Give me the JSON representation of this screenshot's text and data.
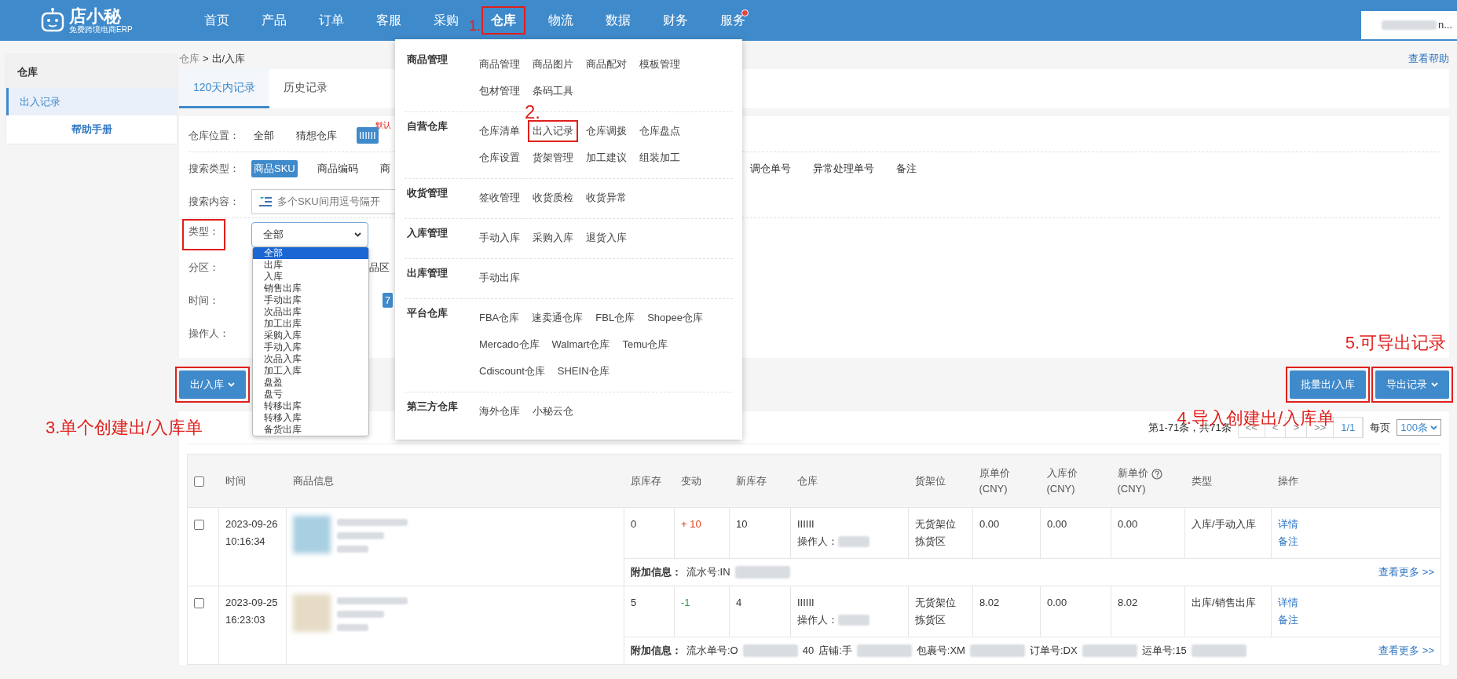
{
  "nav": {
    "logo": "店小秘",
    "tagline": "免费跨境电商ERP",
    "user": "n...",
    "items": [
      {
        "label": "首页",
        "selected": false,
        "outlined": false,
        "dot": false
      },
      {
        "label": "产品",
        "selected": false,
        "outlined": false,
        "dot": false
      },
      {
        "label": "订单",
        "selected": false,
        "outlined": false,
        "dot": false
      },
      {
        "label": "客服",
        "selected": false,
        "outlined": false,
        "dot": false
      },
      {
        "label": "采购",
        "selected": false,
        "outlined": false,
        "dot": false
      },
      {
        "label": "仓库",
        "selected": true,
        "outlined": true,
        "dot": false,
        "step": "1."
      },
      {
        "label": "物流",
        "selected": false,
        "outlined": false,
        "dot": false
      },
      {
        "label": "数据",
        "selected": false,
        "outlined": false,
        "dot": false
      },
      {
        "label": "财务",
        "selected": false,
        "outlined": false,
        "dot": false
      },
      {
        "label": "服务",
        "selected": false,
        "outlined": false,
        "dot": true
      }
    ]
  },
  "mega_menu": [
    {
      "title": "商品管理",
      "lines": [
        [
          {
            "label": "商品管理",
            "outlined": false
          },
          {
            "label": "商品图片",
            "outlined": false
          },
          {
            "label": "商品配对",
            "outlined": false
          },
          {
            "label": "模板管理",
            "outlined": false
          }
        ],
        [
          {
            "label": "包材管理",
            "outlined": false
          },
          {
            "label": "条码工具",
            "outlined": false
          }
        ]
      ]
    },
    {
      "title": "自营仓库",
      "lines": [
        [
          {
            "label": "仓库清单",
            "outlined": false
          },
          {
            "label": "出入记录",
            "outlined": true,
            "step": "2."
          },
          {
            "label": "仓库调拨",
            "outlined": false
          },
          {
            "label": "仓库盘点",
            "outlined": false
          }
        ],
        [
          {
            "label": "仓库设置",
            "outlined": false
          },
          {
            "label": "货架管理",
            "outlined": false
          },
          {
            "label": "加工建议",
            "outlined": false
          },
          {
            "label": "组装加工",
            "outlined": false
          }
        ]
      ]
    },
    {
      "title": "收货管理",
      "lines": [
        [
          {
            "label": "签收管理",
            "outlined": false
          },
          {
            "label": "收货质检",
            "outlined": false
          },
          {
            "label": "收货异常",
            "outlined": false
          }
        ]
      ]
    },
    {
      "title": "入库管理",
      "lines": [
        [
          {
            "label": "手动入库",
            "outlined": false
          },
          {
            "label": "采购入库",
            "outlined": false
          },
          {
            "label": "退货入库",
            "outlined": false
          }
        ]
      ]
    },
    {
      "title": "出库管理",
      "lines": [
        [
          {
            "label": "手动出库",
            "outlined": false
          }
        ]
      ]
    },
    {
      "title": "平台仓库",
      "lines": [
        [
          {
            "label": "FBA仓库",
            "outlined": false
          },
          {
            "label": "速卖通仓库",
            "outlined": false
          },
          {
            "label": "FBL仓库",
            "outlined": false
          },
          {
            "label": "Shopee仓库",
            "outlined": false
          }
        ],
        [
          {
            "label": "Mercado仓库",
            "outlined": false
          },
          {
            "label": "Walmart仓库",
            "outlined": false
          },
          {
            "label": "Temu仓库",
            "outlined": false
          }
        ],
        [
          {
            "label": "Cdiscount仓库",
            "outlined": false
          },
          {
            "label": "SHEIN仓库",
            "outlined": false
          }
        ]
      ]
    },
    {
      "title": "第三方仓库",
      "lines": [
        [
          {
            "label": "海外仓库",
            "outlined": false
          },
          {
            "label": "小秘云仓",
            "outlined": false
          }
        ]
      ]
    }
  ],
  "sidebar": {
    "title": "仓库",
    "items": [
      {
        "label": "出入记录",
        "selected": true
      }
    ],
    "help": "帮助手册"
  },
  "breadcrumb": [
    "仓库",
    "出/入库"
  ],
  "breadcrumb_separator": ">",
  "help_link": "查看帮助",
  "tabs": [
    {
      "label": "120天内记录",
      "selected": true
    },
    {
      "label": "历史记录",
      "selected": false
    }
  ],
  "filters": [
    {
      "label": "仓库位置：",
      "outlined": false,
      "kind": "options",
      "options": [
        {
          "label": "全部",
          "selected": false
        },
        {
          "label": "猜想仓库",
          "selected": false
        },
        {
          "label": "IIIIII",
          "selected": true,
          "tag": "默认"
        }
      ]
    },
    {
      "label": "搜索类型：",
      "outlined": false,
      "kind": "options",
      "options": [
        {
          "label": "商品SKU",
          "selected": true
        },
        {
          "label": "商品编码",
          "selected": false
        },
        {
          "label": "商",
          "selected": false
        }
      ],
      "options_right": [
        {
          "label": "调仓单号",
          "selected": false
        },
        {
          "label": "异常处理单号",
          "selected": false
        },
        {
          "label": "备注",
          "selected": false
        }
      ]
    },
    {
      "label": "搜索内容：",
      "outlined": false,
      "kind": "search",
      "placeholder": "多个SKU间用逗号隔开"
    },
    {
      "label": "类型：",
      "outlined": true,
      "kind": "select",
      "value": "全部",
      "choices": [
        {
          "label": "全部",
          "selected": true
        },
        {
          "label": "出库",
          "selected": false
        },
        {
          "label": "入库",
          "selected": false
        },
        {
          "label": "销售出库",
          "selected": false
        },
        {
          "label": "手动出库",
          "selected": false
        },
        {
          "label": "次品出库",
          "selected": false
        },
        {
          "label": "加工出库",
          "selected": false
        },
        {
          "label": "采购入库",
          "selected": false
        },
        {
          "label": "手动入库",
          "selected": false
        },
        {
          "label": "次品入库",
          "selected": false
        },
        {
          "label": "加工入库",
          "selected": false
        },
        {
          "label": "盘盈",
          "selected": false
        },
        {
          "label": "盘亏",
          "selected": false
        },
        {
          "label": "转移出库",
          "selected": false
        },
        {
          "label": "转移入库",
          "selected": false
        },
        {
          "label": "备货出库",
          "selected": false
        }
      ]
    },
    {
      "label": "分区：",
      "outlined": false,
      "kind": "partial",
      "text": "品区"
    },
    {
      "label": "时间：",
      "outlined": false,
      "kind": "chip",
      "text": "7"
    },
    {
      "label": "操作人：",
      "outlined": false,
      "kind": "empty"
    }
  ],
  "actions": [
    {
      "label": "出/入库",
      "caret": true,
      "outlined": true,
      "note": "3.单个创建出/入库单"
    },
    {
      "label": "批量出/入库",
      "caret": false,
      "outlined": true,
      "note": "4.导入创建出/入库单"
    },
    {
      "label": "导出记录",
      "caret": true,
      "outlined": true,
      "note": "5.可导出记录"
    }
  ],
  "pagination": {
    "summary": "第1-71条，共71条",
    "buttons": [
      {
        "label": "<<",
        "selected": false
      },
      {
        "label": "<",
        "selected": false
      },
      {
        "label": ">",
        "selected": false
      },
      {
        "label": ">>",
        "selected": false
      },
      {
        "label": "1/1",
        "selected": true
      }
    ],
    "per_page_label": "每页",
    "per_page": "100条"
  },
  "table": {
    "all_checked": false,
    "columns": [
      {
        "label": "时间"
      },
      {
        "label": "商品信息"
      },
      {
        "label": "原库存"
      },
      {
        "label": "变动"
      },
      {
        "label": "新库存"
      },
      {
        "label": "仓库"
      },
      {
        "label": "货架位"
      },
      {
        "label": "原单价 (CNY)"
      },
      {
        "label": "入库价 (CNY)"
      },
      {
        "label": "新单价",
        "help": true,
        "sub": "(CNY)"
      },
      {
        "label": "类型"
      },
      {
        "label": "操作"
      }
    ],
    "rows": [
      {
        "checked": false,
        "time": "2023-09-26 10:16:34",
        "old_stock": "0",
        "change": "+ 10",
        "color": "#e0401c",
        "new_stock": "10",
        "warehouse": "IIIIII",
        "operator_label": "操作人：",
        "shelf": [
          "无货架位",
          "拣货区"
        ],
        "old_price": "0.00",
        "in_price": "0.00",
        "new_price": "0.00",
        "type": "入库/手动入库",
        "ops": [
          "详情",
          "备注"
        ],
        "extra_label": "附加信息：",
        "extra": [
          {
            "kind": "text",
            "text": "流水号:IN"
          },
          {
            "kind": "redacted"
          }
        ],
        "more": "查看更多 >>"
      },
      {
        "checked": false,
        "time": "2023-09-25 16:23:03",
        "old_stock": "5",
        "change": "-1",
        "color": "#2e9b4a",
        "new_stock": "4",
        "warehouse": "IIIIII",
        "operator_label": "操作人：",
        "shelf": [
          "无货架位",
          "拣货区"
        ],
        "old_price": "8.02",
        "in_price": "0.00",
        "new_price": "8.02",
        "type": "出库/销售出库",
        "ops": [
          "详情",
          "备注"
        ],
        "extra_label": "附加信息：",
        "extra": [
          {
            "kind": "text",
            "text": "流水单号:O"
          },
          {
            "kind": "redacted"
          },
          {
            "kind": "text",
            "text": "40"
          },
          {
            "kind": "text",
            "text": "店铺:手"
          },
          {
            "kind": "redacted"
          },
          {
            "kind": "text",
            "text": "包裹号:XM"
          },
          {
            "kind": "redacted"
          },
          {
            "kind": "text",
            "text": "订单号:DX"
          },
          {
            "kind": "redacted"
          },
          {
            "kind": "text",
            "text": "运单号:15"
          },
          {
            "kind": "redacted"
          }
        ],
        "more": "查看更多 >>"
      }
    ]
  }
}
